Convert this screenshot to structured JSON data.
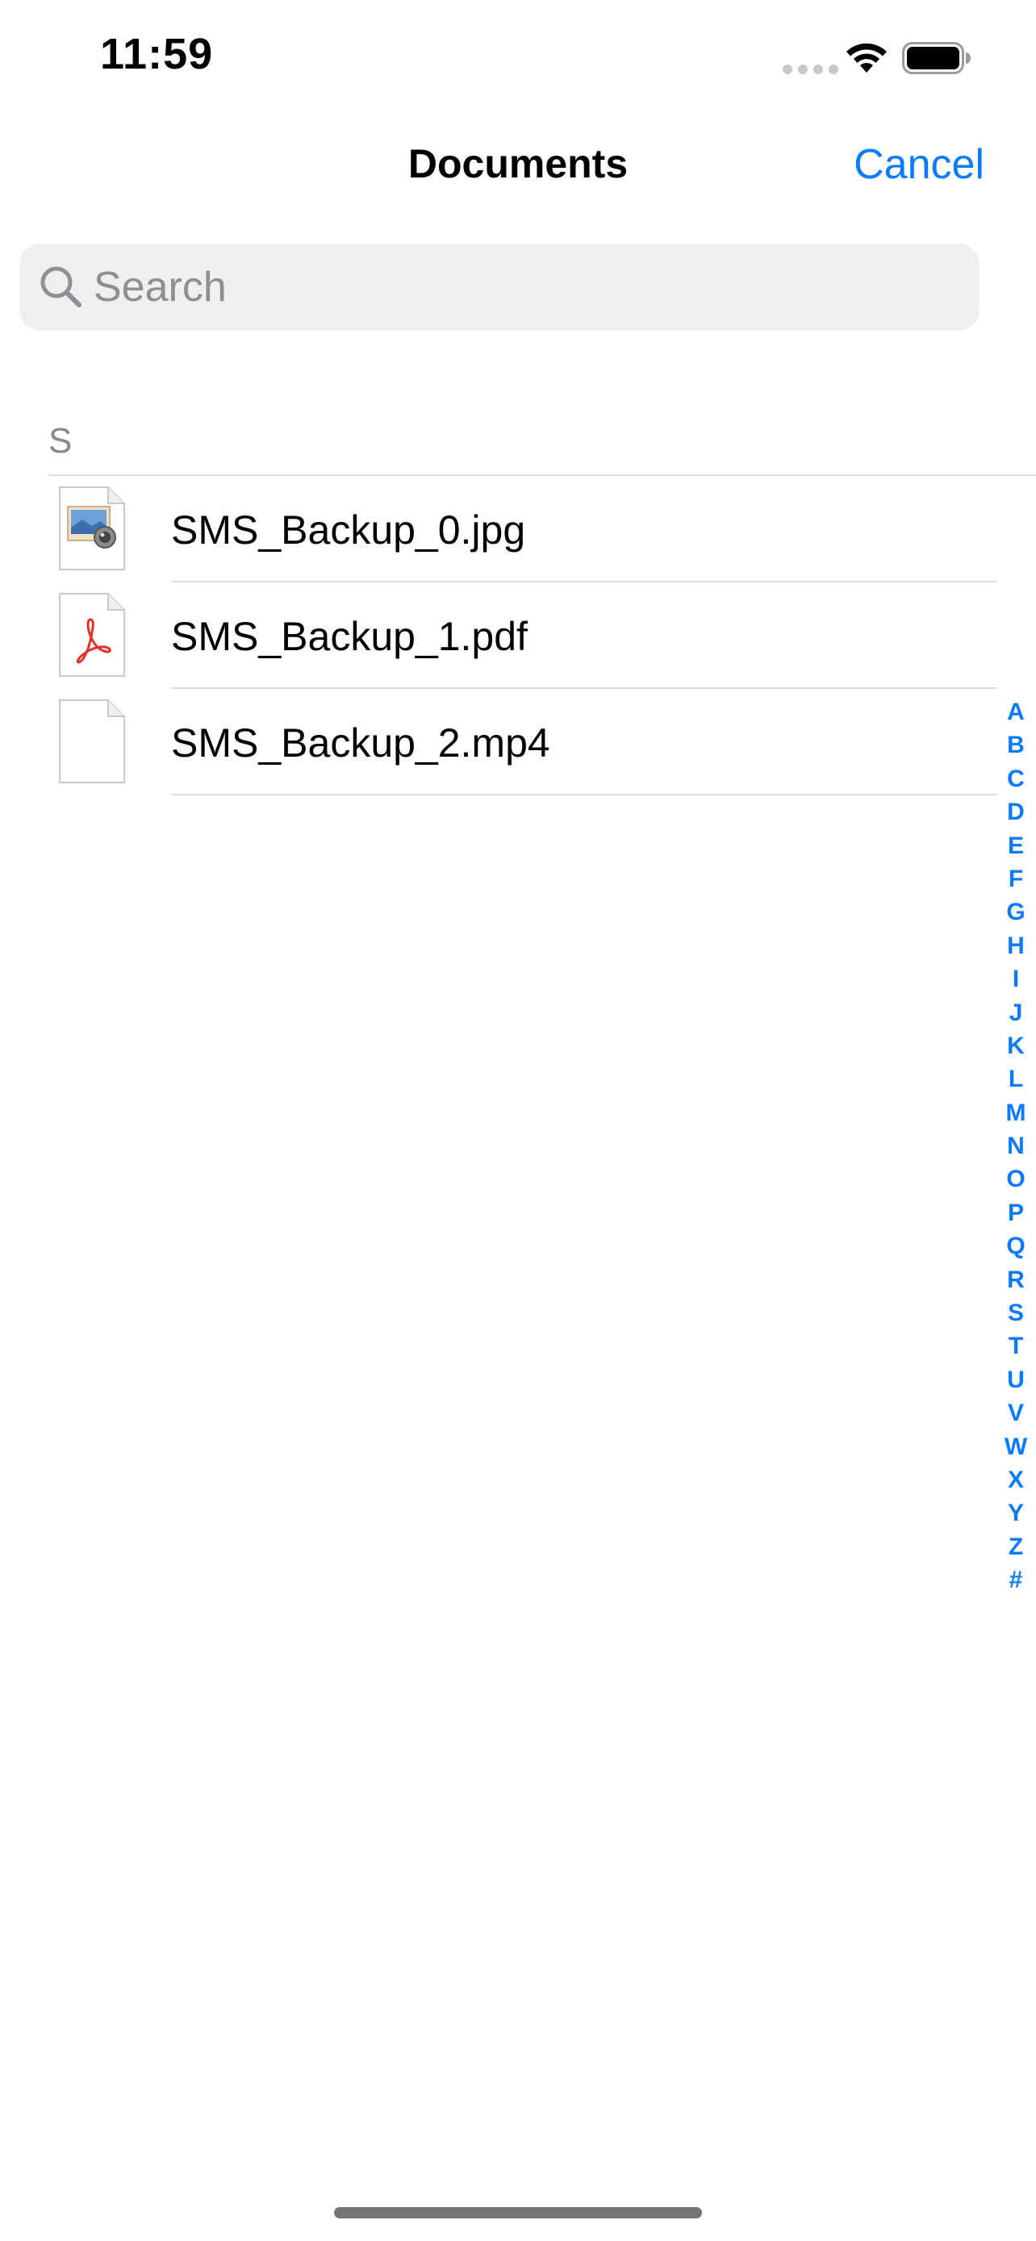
{
  "status_bar": {
    "time": "11:59",
    "signal_icon": "cellular-signal-dots",
    "wifi_icon": "wifi-icon",
    "battery_icon": "battery-full-icon"
  },
  "nav": {
    "title": "Documents",
    "cancel_label": "Cancel"
  },
  "search": {
    "placeholder": "Search",
    "value": "",
    "icon": "magnifying-glass"
  },
  "sections": [
    {
      "header": "S",
      "files": [
        {
          "name": "SMS_Backup_0.jpg",
          "icon": "image-file-icon"
        },
        {
          "name": "SMS_Backup_1.pdf",
          "icon": "pdf-file-icon"
        },
        {
          "name": "SMS_Backup_2.mp4",
          "icon": "blank-file-icon"
        }
      ]
    }
  ],
  "index_letters": [
    "A",
    "B",
    "C",
    "D",
    "E",
    "F",
    "G",
    "H",
    "I",
    "J",
    "K",
    "L",
    "M",
    "N",
    "O",
    "P",
    "Q",
    "R",
    "S",
    "T",
    "U",
    "V",
    "W",
    "X",
    "Y",
    "Z",
    "#"
  ],
  "colors": {
    "accent": "#0a7aff",
    "section_header": "#8a8a8e",
    "search_background": "#efefef",
    "separator": "#dcdcdc"
  }
}
